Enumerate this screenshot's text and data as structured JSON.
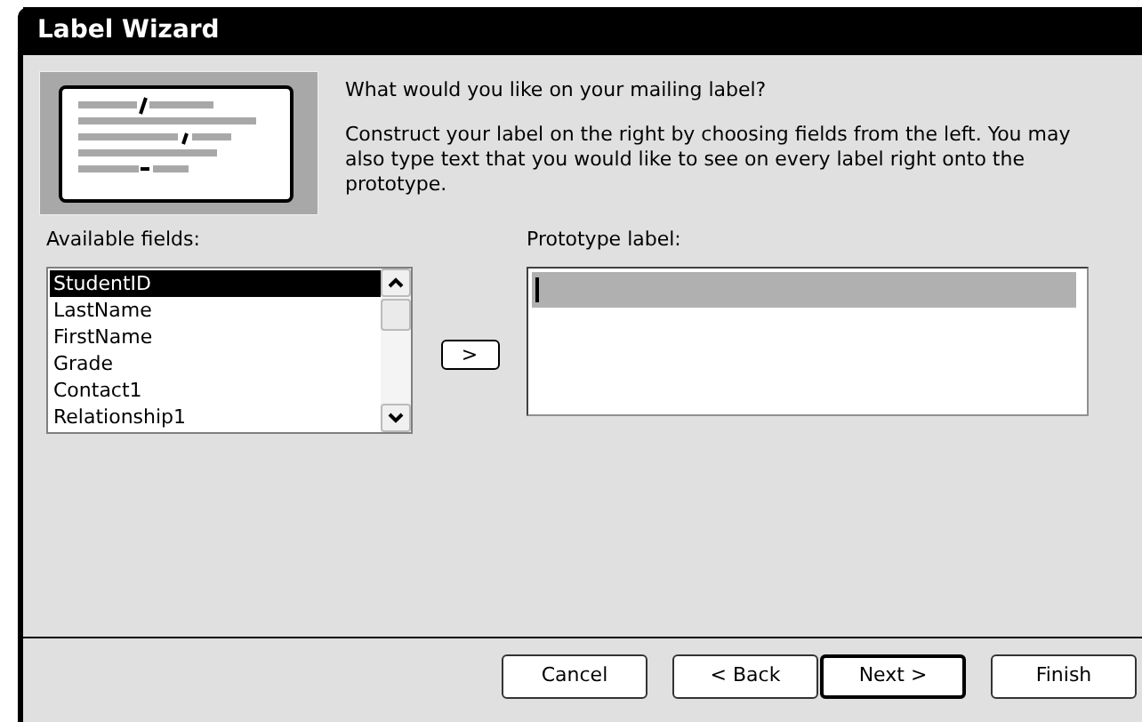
{
  "window": {
    "title": "Label Wizard"
  },
  "intro": {
    "question": "What would you like on your mailing label?",
    "instructions": "Construct your label on the right by choosing fields from the left. You may also type text that you would like to see on every label right onto the prototype."
  },
  "available_fields": {
    "label": "Available fields:",
    "items": [
      {
        "text": "StudentID",
        "selected": true
      },
      {
        "text": "LastName",
        "selected": false
      },
      {
        "text": "FirstName",
        "selected": false
      },
      {
        "text": "Grade",
        "selected": false
      },
      {
        "text": "Contact1",
        "selected": false
      },
      {
        "text": "Relationship1",
        "selected": false
      }
    ]
  },
  "add_button": ">",
  "prototype": {
    "label": "Prototype label:"
  },
  "buttons": [
    {
      "text": "Cancel",
      "default": false
    },
    {
      "text": "< Back",
      "default": false
    },
    {
      "text": "Next >",
      "default": true
    },
    {
      "text": "Finish",
      "default": false
    }
  ]
}
